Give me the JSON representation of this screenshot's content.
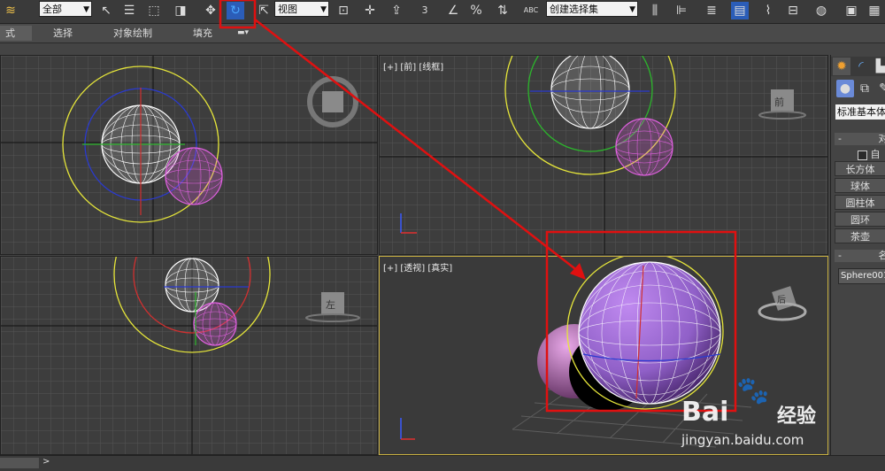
{
  "toolbar": {
    "selection_filter": "全部",
    "reference_coord": "视图",
    "named_selection": "创建选择集",
    "snap_angle_label": "3",
    "percent_label": "%",
    "abc_label": "ABC"
  },
  "ribbon": {
    "tabs": [
      "式",
      "选择",
      "对象绘制",
      "填充"
    ]
  },
  "viewports": {
    "top_left": {
      "label": "",
      "navcube": ""
    },
    "top_right": {
      "label": "[+] [前] [线框]",
      "navcube": "前"
    },
    "bottom_left": {
      "label": "",
      "navcube": "左"
    },
    "bottom_right": {
      "label": "[+] [透视] [真实]",
      "navcube": "后"
    }
  },
  "command_panel": {
    "category": "标准基本体",
    "section_object_type": "对",
    "autogrid_label": "自",
    "buttons": [
      "长方体",
      "球体",
      "圆柱体",
      "圆环",
      "茶壶"
    ],
    "section_name": "名",
    "object_name": "Sphere001"
  },
  "status": {
    "arrow": ">"
  },
  "watermark": {
    "brand": "Bai",
    "brand2": "经验",
    "url": "jingyan.baidu.com"
  },
  "colors": {
    "highlight_red": "#e01010",
    "viewport_bg": "#3d3d3d",
    "grid": "#555555",
    "sphere_pink": "#e060e0",
    "gizmo_yellow": "#e6e63a",
    "sphere_purple": "#9e6ad4"
  }
}
